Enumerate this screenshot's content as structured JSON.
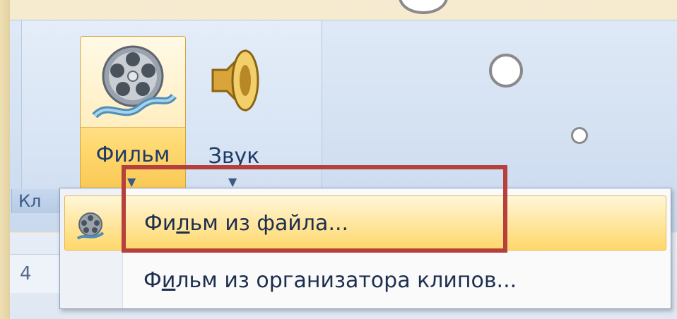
{
  "ribbon": {
    "group_label": "Кл",
    "film_button": {
      "label": "Фильм",
      "icon": "film-reel-icon"
    },
    "sound_button": {
      "label": "Звук",
      "icon": "speaker-icon"
    }
  },
  "menu": {
    "items": [
      {
        "label_prefix": "Фи",
        "label_underline": "л",
        "label_suffix": "ьм из файла...",
        "icon": "film-reel-icon",
        "active": true
      },
      {
        "label_prefix": "Ф",
        "label_underline": "и",
        "label_suffix": "льм из организатора клипов...",
        "active": false
      }
    ]
  },
  "slide": {
    "row_number": "4"
  },
  "colors": {
    "highlight": "#b5403c",
    "ribbon": "#d3e1f2",
    "hover": "#ffd86a",
    "text": "#1d2f4f"
  }
}
